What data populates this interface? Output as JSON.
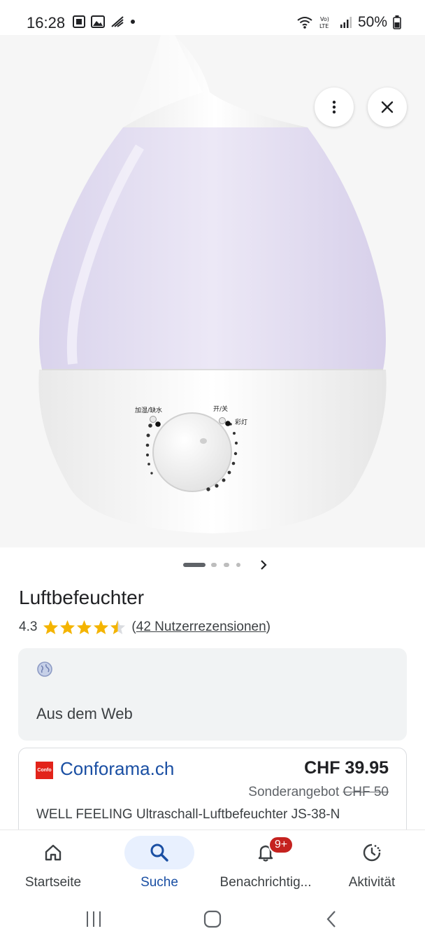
{
  "status_bar": {
    "time": "16:28",
    "battery": "50%"
  },
  "hero": {
    "dial_label_left": "加湿/缺水",
    "dial_label_top": "开/关",
    "dial_label_right": "彩灯"
  },
  "pager": {
    "total": 4,
    "active_index": 0
  },
  "product": {
    "title": "Luftbefeuchter",
    "rating": "4.3",
    "rating_value": 4.3,
    "stars_max": 5,
    "reviews_open": "(",
    "reviews_text": "42 Nutzerrezensionen",
    "reviews_close": ")"
  },
  "web_card": {
    "label": "Aus dem Web"
  },
  "offer": {
    "logo_text": "Confo",
    "store": "Conforama.ch",
    "price": "CHF 39.95",
    "deal_label": "Sonderangebot",
    "old_price": "CHF 50",
    "description": "WELL FEELING Ultraschall-Luftbefeuchter JS-38-N"
  },
  "bottom_nav": {
    "items": [
      {
        "label": "Startseite",
        "icon": "home-icon"
      },
      {
        "label": "Suche",
        "icon": "search-icon"
      },
      {
        "label": "Benachrichtig...",
        "icon": "bell-icon",
        "badge": "9+"
      },
      {
        "label": "Aktivität",
        "icon": "activity-icon"
      }
    ],
    "active_index": 1
  },
  "colors": {
    "accent": "#1a4fa3",
    "active_pill": "#e8f0fe",
    "badge": "#c5221f",
    "star": "#f4b400",
    "store_logo": "#e2231a"
  }
}
